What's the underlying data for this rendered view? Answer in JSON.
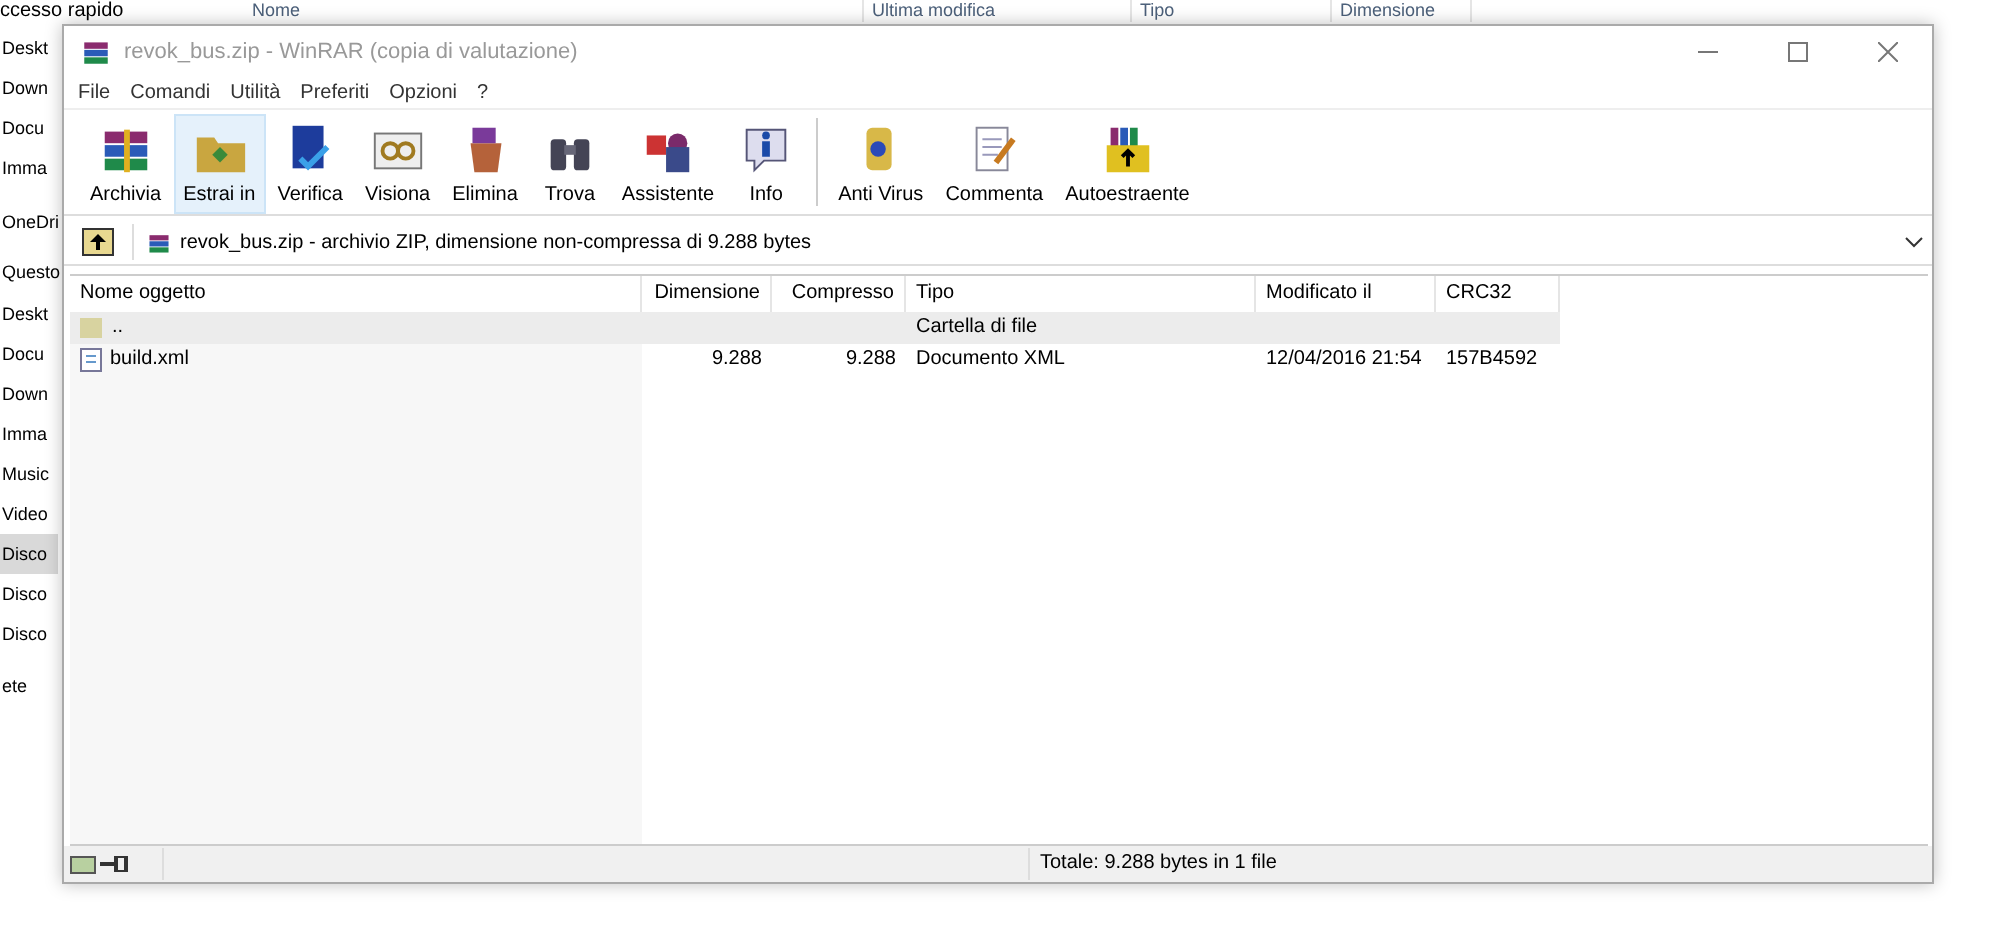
{
  "explorer": {
    "columns": [
      "Nome",
      "Ultima modifica",
      "Tipo",
      "Dimensione"
    ],
    "sidebar": [
      {
        "label": "ccesso rapido",
        "selected": false
      },
      {
        "label": "Deskt",
        "selected": false
      },
      {
        "label": "Down",
        "selected": false
      },
      {
        "label": "Docu",
        "selected": false
      },
      {
        "label": "Imma",
        "selected": false
      },
      {
        "label": "OneDri",
        "selected": false
      },
      {
        "label": "Questo",
        "selected": false
      },
      {
        "label": "Deskt",
        "selected": false
      },
      {
        "label": "Docu",
        "selected": false
      },
      {
        "label": "Down",
        "selected": false
      },
      {
        "label": "Imma",
        "selected": false
      },
      {
        "label": "Music",
        "selected": false
      },
      {
        "label": "Video",
        "selected": false
      },
      {
        "label": "Disco",
        "selected": true
      },
      {
        "label": "Disco",
        "selected": false
      },
      {
        "label": "Disco",
        "selected": false
      },
      {
        "label": "ete",
        "selected": false
      }
    ]
  },
  "window": {
    "title": "revok_bus.zip - WinRAR (copia di valutazione)",
    "menu": [
      "File",
      "Comandi",
      "Utilità",
      "Preferiti",
      "Opzioni",
      "?"
    ],
    "toolbar": [
      {
        "label": "Archivia",
        "selected": false
      },
      {
        "label": "Estrai in",
        "selected": true
      },
      {
        "label": "Verifica",
        "selected": false
      },
      {
        "label": "Visiona",
        "selected": false
      },
      {
        "label": "Elimina",
        "selected": false
      },
      {
        "label": "Trova",
        "selected": false
      },
      {
        "label": "Assistente",
        "selected": false
      },
      {
        "label": "Info",
        "selected": false
      },
      {
        "label": "Anti Virus",
        "selected": false
      },
      {
        "label": "Commenta",
        "selected": false
      },
      {
        "label": "Autoestraente",
        "selected": false
      }
    ],
    "address": "revok_bus.zip - archivio ZIP, dimensione non-compressa di 9.288 bytes",
    "table": {
      "columns": [
        "Nome oggetto",
        "Dimensione",
        "Compresso",
        "Tipo",
        "Modificato il",
        "CRC32"
      ],
      "rows": [
        {
          "kind": "folder",
          "selected": true,
          "cells": [
            "..",
            "",
            "",
            "Cartella di file",
            "",
            ""
          ]
        },
        {
          "kind": "file",
          "selected": false,
          "cells": [
            "build.xml",
            "9.288",
            "9.288",
            "Documento XML",
            "12/04/2016 21:54",
            "157B4592"
          ]
        }
      ]
    },
    "status": "Totale: 9.288 bytes in 1 file"
  }
}
